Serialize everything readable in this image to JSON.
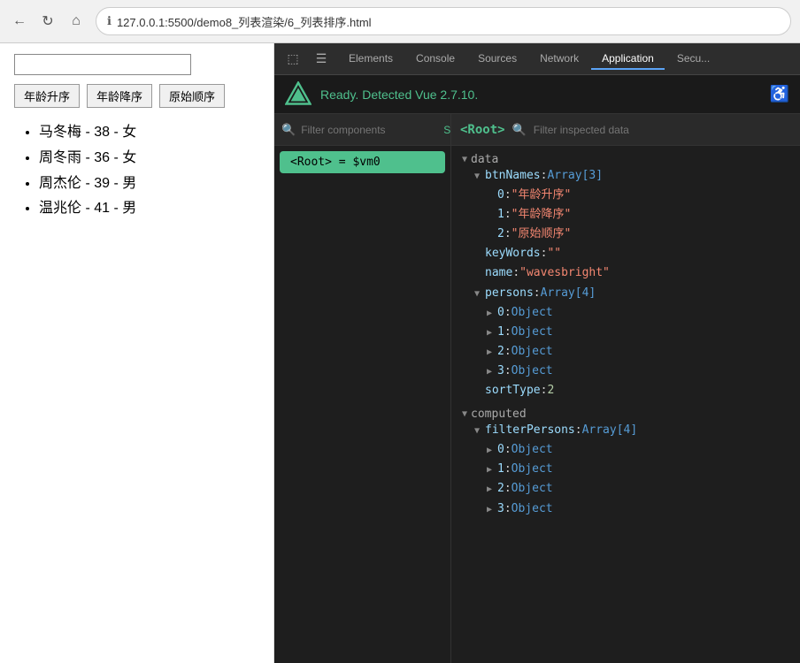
{
  "browser": {
    "url": "127.0.0.1:5500/demo8_列表渲染/6_列表排序.html",
    "back_disabled": false,
    "forward_disabled": true
  },
  "devtools": {
    "tabs": [
      "Elements",
      "Console",
      "Sources",
      "Network",
      "Application",
      "Secu..."
    ],
    "active_tab": "Application",
    "vue_status": "Ready. Detected Vue 2.7.10."
  },
  "webpage": {
    "search_placeholder": "",
    "search_value": "",
    "buttons": [
      "年龄升序",
      "年龄降序",
      "原始顺序"
    ],
    "persons": [
      "马冬梅 - 38 - 女",
      "周冬雨 - 36 - 女",
      "周杰伦 - 39 - 男",
      "温兆伦 - 41 - 男"
    ]
  },
  "component_tree": {
    "search_placeholder": "Filter components",
    "select_label": "Select",
    "items": [
      {
        "label": "<Root> = $vm0",
        "selected": true
      }
    ]
  },
  "data_inspector": {
    "root_label": "<Root>",
    "filter_placeholder": "Filter inspected data",
    "sections": {
      "data_label": "data",
      "computed_label": "computed"
    },
    "data": {
      "btnNames_label": "btnNames",
      "btnNames_type": "Array[3]",
      "btnNames_items": [
        "\"年龄升序\"",
        "\"年龄降序\"",
        "\"原始顺序\""
      ],
      "keyWords_label": "keyWords",
      "keyWords_value": "\"\"",
      "name_label": "name",
      "name_value": "\"wavesbright\"",
      "persons_label": "persons",
      "persons_type": "Array[4]",
      "persons_items": [
        "Object",
        "Object",
        "Object",
        "Object"
      ],
      "sortType_label": "sortType",
      "sortType_value": "2"
    },
    "computed": {
      "filterPersons_label": "filterPersons",
      "filterPersons_type": "Array[4]",
      "filterPersons_items": [
        "Object",
        "Object",
        "Object",
        "Object"
      ]
    }
  },
  "icons": {
    "back": "←",
    "refresh": "↻",
    "home": "⌂",
    "info": "ℹ",
    "inspect": "⬚",
    "device": "☰",
    "person_icon": "♿"
  }
}
